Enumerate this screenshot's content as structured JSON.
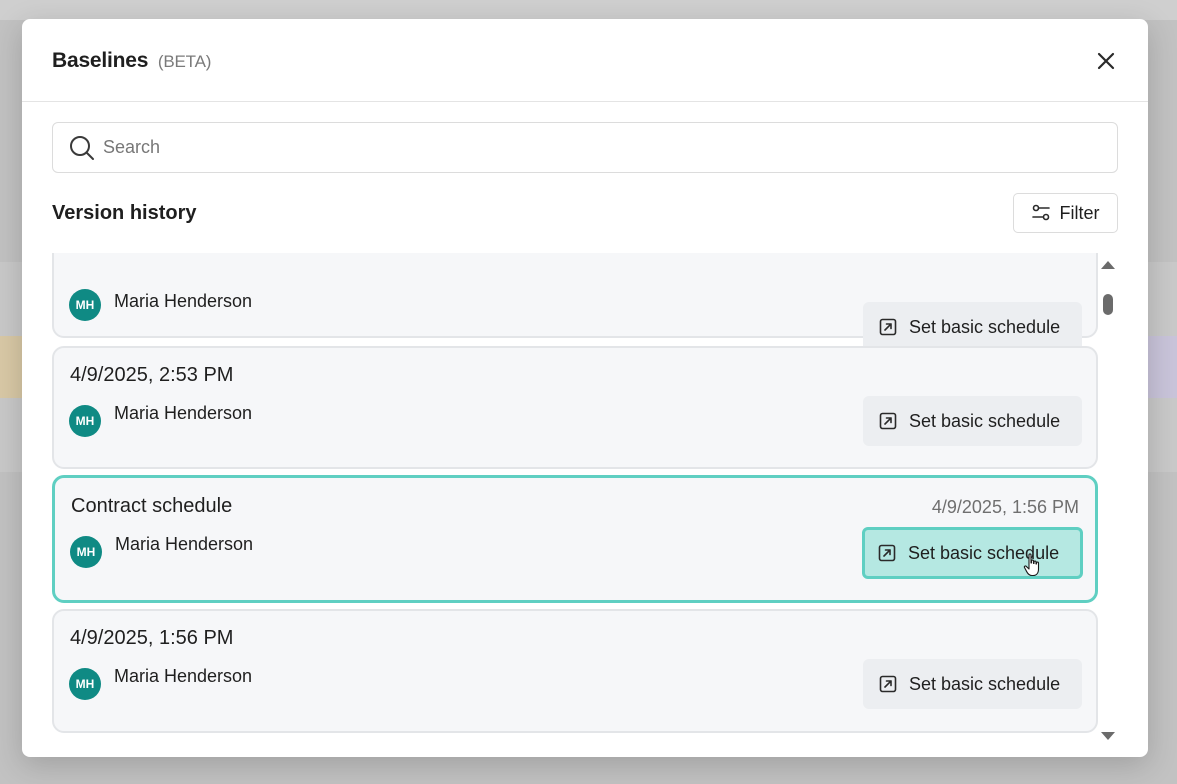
{
  "modal": {
    "title": "Baselines",
    "title_tag": "(BETA)",
    "close_icon": "close-icon"
  },
  "search": {
    "placeholder": "Search",
    "value": ""
  },
  "section": {
    "title": "Version history",
    "filter_label": "Filter"
  },
  "versions": [
    {
      "title": "",
      "date": "",
      "author_initials": "MH",
      "author": "Maria Henderson",
      "action_label": "Set basic schedule"
    },
    {
      "title": "4/9/2025, 2:53 PM",
      "date": "",
      "author_initials": "MH",
      "author": "Maria Henderson",
      "action_label": "Set basic schedule"
    },
    {
      "title": "Contract schedule",
      "date": "4/9/2025, 1:56 PM",
      "author_initials": "MH",
      "author": "Maria Henderson",
      "action_label": "Set basic schedule",
      "selected": true
    },
    {
      "title": "4/9/2025, 1:56 PM",
      "date": "",
      "author_initials": "MH",
      "author": "Maria Henderson",
      "action_label": "Set basic schedule"
    }
  ],
  "colors": {
    "accent": "#5fcfc2",
    "accent_fill": "#b5e8e2",
    "avatar": "#0f8a84"
  }
}
